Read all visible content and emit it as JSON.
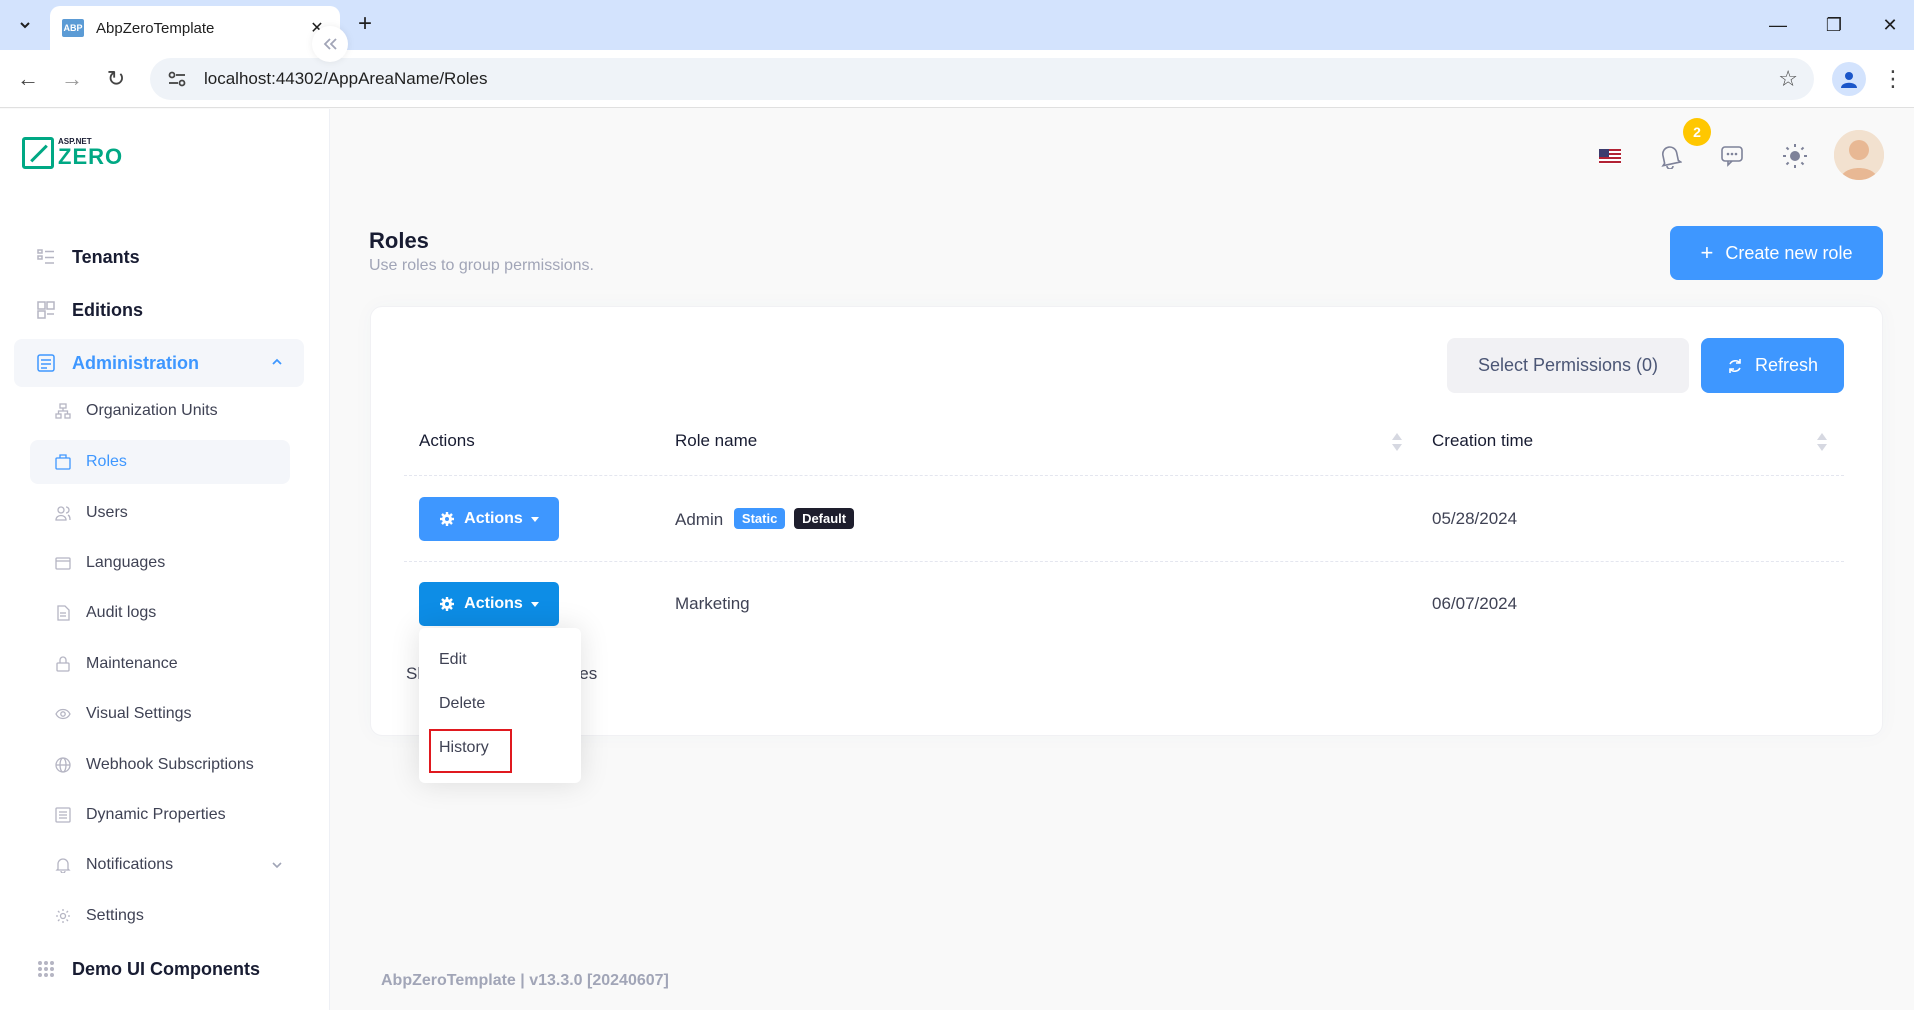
{
  "browser": {
    "tab_title": "AbpZeroTemplate",
    "favicon_text": "ABP",
    "url": "localhost:44302/AppAreaName/Roles"
  },
  "logo": {
    "small": "ASP.NET",
    "big": "ZERO"
  },
  "sidebar": {
    "items": [
      {
        "label": "Tenants",
        "icon": "tenants-icon"
      },
      {
        "label": "Editions",
        "icon": "editions-icon"
      },
      {
        "label": "Administration",
        "icon": "administration-icon"
      },
      {
        "label": "Demo UI Components",
        "icon": "demo-ui-icon"
      }
    ],
    "sub_items": [
      {
        "label": "Organization Units",
        "icon": "org-units-icon"
      },
      {
        "label": "Roles",
        "icon": "roles-icon"
      },
      {
        "label": "Users",
        "icon": "users-icon"
      },
      {
        "label": "Languages",
        "icon": "languages-icon"
      },
      {
        "label": "Audit logs",
        "icon": "audit-logs-icon"
      },
      {
        "label": "Maintenance",
        "icon": "lock-icon"
      },
      {
        "label": "Visual Settings",
        "icon": "eye-icon"
      },
      {
        "label": "Webhook Subscriptions",
        "icon": "globe-icon"
      },
      {
        "label": "Dynamic Properties",
        "icon": "properties-icon"
      },
      {
        "label": "Notifications",
        "icon": "bell-icon"
      },
      {
        "label": "Settings",
        "icon": "gear-icon"
      }
    ]
  },
  "header": {
    "notification_count": "2"
  },
  "page": {
    "title": "Roles",
    "subtitle": "Use roles to group permissions.",
    "create_button": "Create new role",
    "select_permissions_button": "Select Permissions (0)",
    "refresh_button": "Refresh"
  },
  "table": {
    "columns": [
      "Actions",
      "Role name",
      "Creation time"
    ],
    "actions_label": "Actions",
    "rows": [
      {
        "role_name": "Admin",
        "badges": [
          "Static",
          "Default"
        ],
        "creation_time": "05/28/2024"
      },
      {
        "role_name": "Marketing",
        "badges": [],
        "creation_time": "06/07/2024"
      }
    ],
    "showing_prefix": "Sh",
    "showing_suffix": "ries"
  },
  "dropdown": {
    "items": [
      "Edit",
      "Delete",
      "History"
    ]
  },
  "footer": "AbpZeroTemplate | v13.3.0 [20240607]",
  "colors": {
    "primary": "#3e97ff",
    "accent_green": "#00a884",
    "highlight_box": "#e0191f",
    "badge_yellow": "#ffc700"
  }
}
